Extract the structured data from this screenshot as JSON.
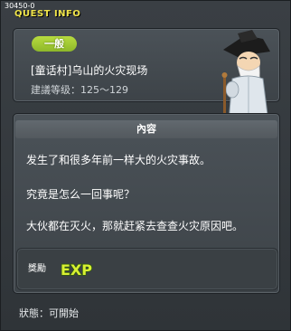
{
  "window": {
    "quest_id": "30450-0",
    "title": "QUEST INFO"
  },
  "quest": {
    "category": "一般",
    "name": "[童话村]乌山的火灾现场",
    "level_req": "建議等级：125～129"
  },
  "content": {
    "header": "內容",
    "lines": [
      "发生了和很多年前一样大的火灾事故。",
      "究竟是怎么一回事呢？",
      "大伙都在灭火，那就赶紧去查查火灾原因吧。"
    ]
  },
  "reward": {
    "label": "獎勵",
    "item": "EXP"
  },
  "status": "狀態：可開始",
  "icons": {
    "npc": "old-sage-npc-icon",
    "exp": "exp-icon"
  },
  "colors": {
    "title": "#f0e44a",
    "badge": "#a6cc35",
    "exp": "#d8f032"
  }
}
